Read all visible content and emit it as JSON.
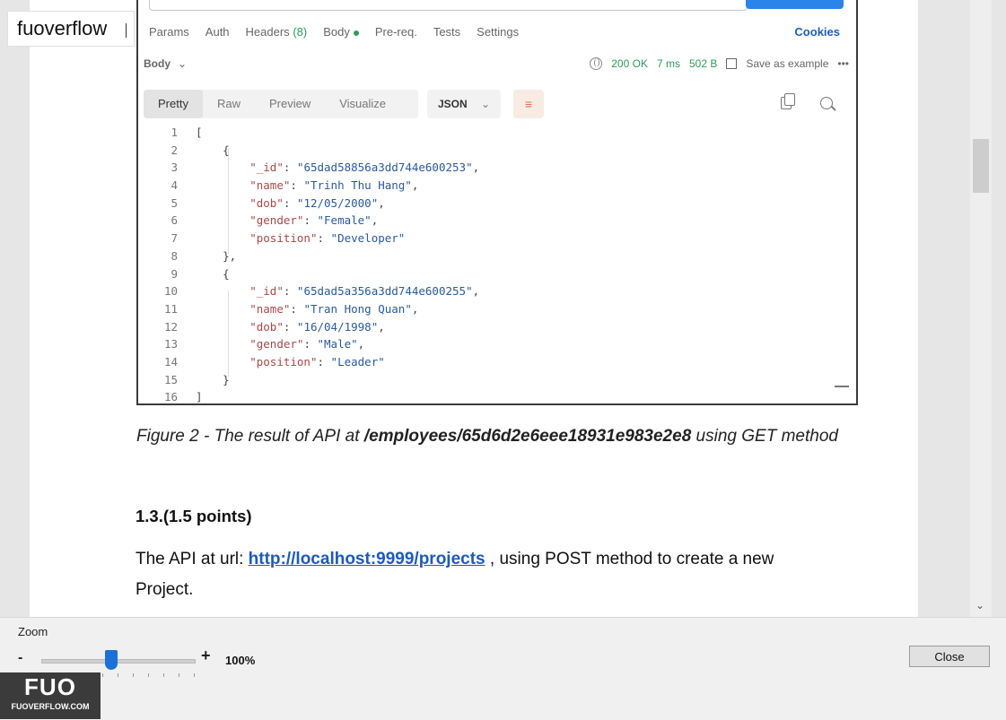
{
  "brand_label": "fuoverflow",
  "postman": {
    "request_tabs": [
      "Params",
      "Auth",
      "Headers",
      "Body",
      "Pre-req.",
      "Tests",
      "Settings"
    ],
    "headers_count": "(8)",
    "cookies": "Cookies",
    "response_section": "Body",
    "status": "200 OK",
    "time": "7 ms",
    "size": "502 B",
    "save_example": "Save as example",
    "more": "•••",
    "view_tabs": [
      "Pretty",
      "Raw",
      "Preview",
      "Visualize"
    ],
    "format": "JSON",
    "code_lines": [
      {
        "n": "1",
        "t": "["
      },
      {
        "n": "2",
        "t": "    {"
      },
      {
        "n": "3",
        "t": "        \"_id\": \"65dad58856a3dd744e600253\","
      },
      {
        "n": "4",
        "t": "        \"name\": \"Trinh Thu Hang\","
      },
      {
        "n": "5",
        "t": "        \"dob\": \"12/05/2000\","
      },
      {
        "n": "6",
        "t": "        \"gender\": \"Female\","
      },
      {
        "n": "7",
        "t": "        \"position\": \"Developer\""
      },
      {
        "n": "8",
        "t": "    },"
      },
      {
        "n": "9",
        "t": "    {"
      },
      {
        "n": "10",
        "t": "        \"_id\": \"65dad5a356a3dd744e600255\","
      },
      {
        "n": "11",
        "t": "        \"name\": \"Tran Hong Quan\","
      },
      {
        "n": "12",
        "t": "        \"dob\": \"16/04/1998\","
      },
      {
        "n": "13",
        "t": "        \"gender\": \"Male\","
      },
      {
        "n": "14",
        "t": "        \"position\": \"Leader\""
      },
      {
        "n": "15",
        "t": "    }"
      },
      {
        "n": "16",
        "t": "]"
      }
    ]
  },
  "document": {
    "caption_prefix": "Figure 2 - The result of API at ",
    "caption_path": "/employees/65d6d2e6eee18931e983e2e8",
    "caption_suffix": " using GET method",
    "section_title": "1.3.(1.5 points)",
    "para_prefix": "The API at url: ",
    "para_link": "http://localhost:9999/projects",
    "para_suffix": " , using POST method to create a new Project."
  },
  "zoom": {
    "label": "Zoom",
    "minus": "-",
    "plus": "+",
    "value": "100%",
    "level_fraction": 0.46
  },
  "close_button": "Close",
  "logo": {
    "big": "FUO",
    "small": "FUOVERFLOW.COM"
  }
}
